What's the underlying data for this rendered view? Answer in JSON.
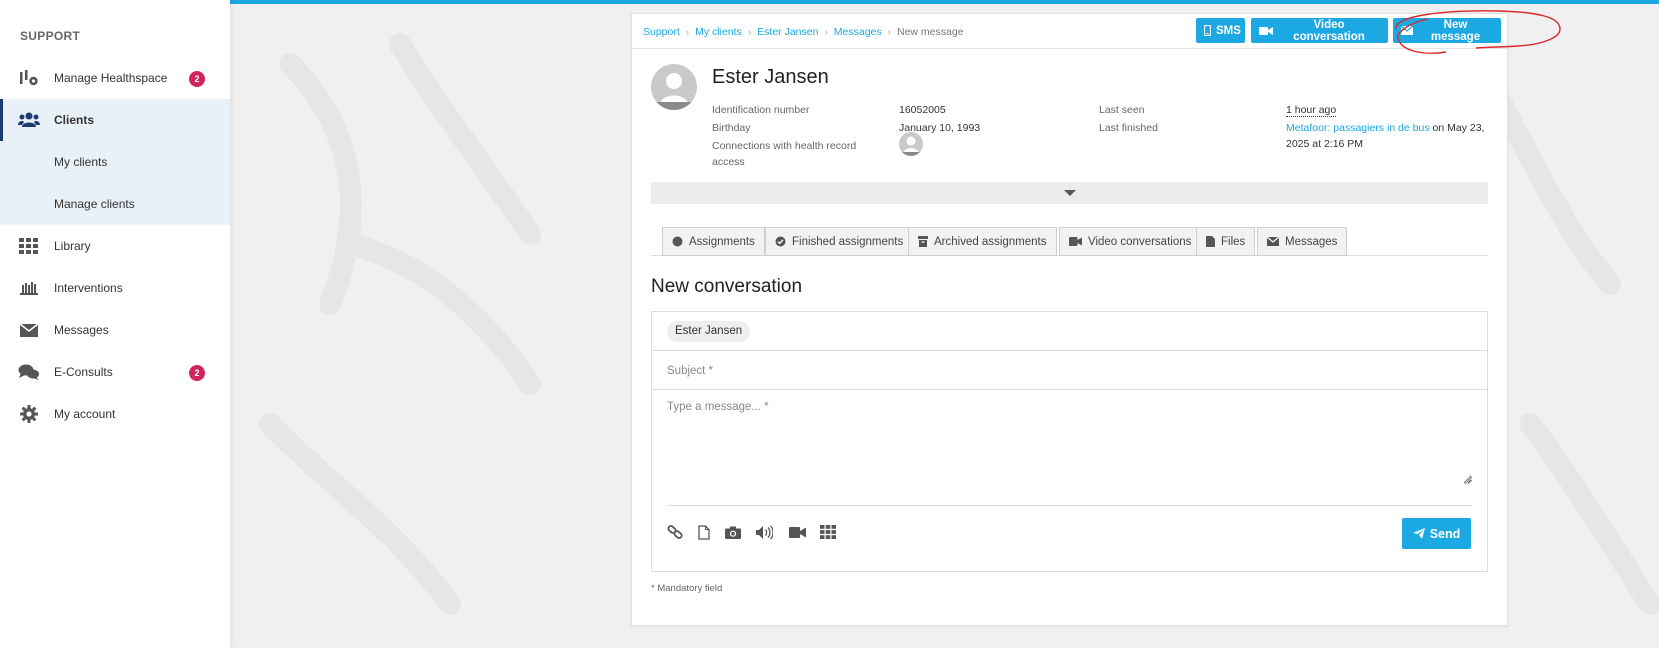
{
  "sidebar": {
    "heading": "SUPPORT",
    "items": [
      {
        "label": "Manage Healthspace",
        "badge": "2"
      },
      {
        "label": "Clients"
      },
      {
        "label": "My clients"
      },
      {
        "label": "Manage clients"
      },
      {
        "label": "Library"
      },
      {
        "label": "Interventions"
      },
      {
        "label": "Messages"
      },
      {
        "label": "E-Consults",
        "badge": "2"
      },
      {
        "label": "My account"
      }
    ]
  },
  "breadcrumb": {
    "items": [
      "Support",
      "My clients",
      "Ester Jansen",
      "Messages"
    ],
    "current": "New message"
  },
  "header_buttons": {
    "sms": "SMS",
    "video": "Video conversation",
    "new_message": "New message"
  },
  "client": {
    "name": "Ester Jansen",
    "id_label": "Identification number",
    "id_value": "16052005",
    "birthday_label": "Birthday",
    "birthday_value": "January 10, 1993",
    "connections_label": "Connections with health record access",
    "last_seen_label": "Last seen",
    "last_seen_value": "1 hour ago",
    "last_finished_label": "Last finished",
    "last_finished_link": "Metafoor: passagiers in de bus",
    "last_finished_rest": "on May 23, 2025 at 2:16 PM"
  },
  "tabs": [
    {
      "label": "Assignments",
      "icon": "circle-icon"
    },
    {
      "label": "Finished assignments",
      "icon": "check-circle-icon"
    },
    {
      "label": "Archived assignments",
      "icon": "archive-icon"
    },
    {
      "label": "Video conversations",
      "icon": "video-icon"
    },
    {
      "label": "Files",
      "icon": "file-icon"
    },
    {
      "label": "Messages",
      "icon": "envelope-icon"
    }
  ],
  "conversation": {
    "title": "New conversation",
    "recipient": "Ester Jansen",
    "subject_placeholder": "Subject *",
    "message_placeholder": "Type a message... *",
    "send_label": "Send",
    "mandatory_note": "* Mandatory field"
  },
  "toolbar_icons": [
    "link-icon",
    "file-icon",
    "camera-icon",
    "audio-icon",
    "video-icon",
    "grid-icon"
  ],
  "colors": {
    "accent": "#1ca8e2",
    "badge": "#d0255c",
    "active_nav": "#e9f1f8",
    "annotation": "#d9262c"
  }
}
